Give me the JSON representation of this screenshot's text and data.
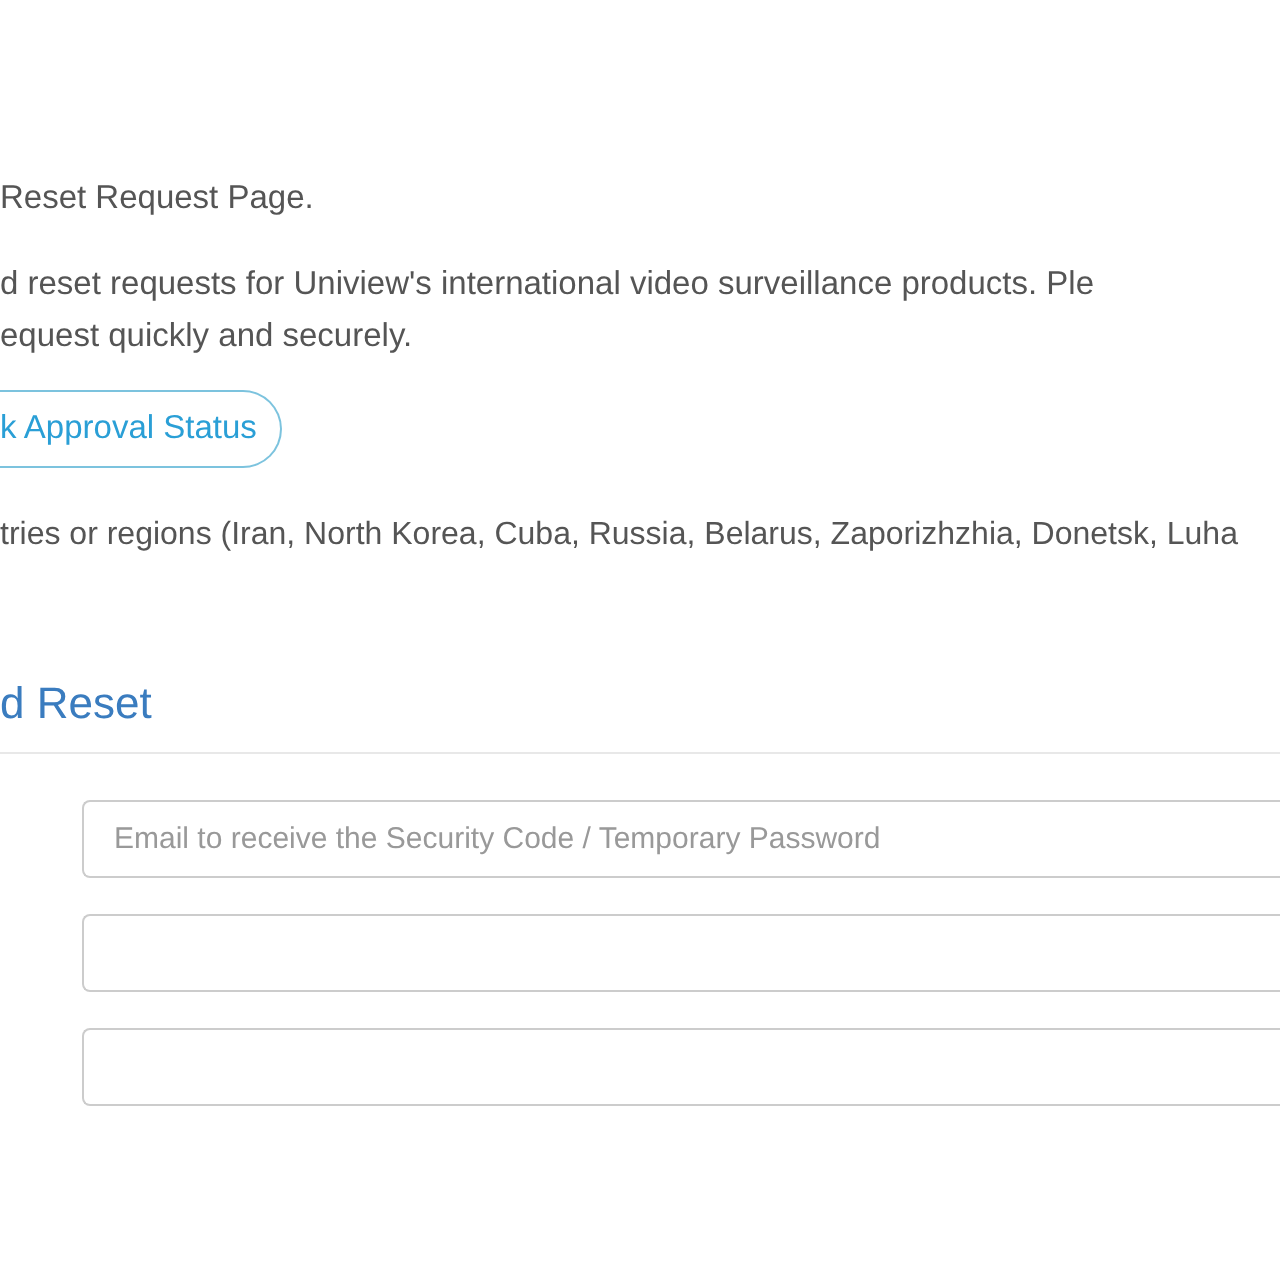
{
  "intro": {
    "lines": [
      "Reset Request Page.",
      "d reset requests for Uniview's international video surveillance products. Ple",
      "equest quickly and securely."
    ]
  },
  "status_button": {
    "label": "k Approval Status"
  },
  "notice": "tries or regions (Iran, North Korea, Cuba, Russia, Belarus, Zaporizhzhia, Donetsk, Luha",
  "form": {
    "title": "d Reset",
    "email_field": {
      "placeholder": "Email to receive the Security Code / Temporary Password"
    }
  }
}
